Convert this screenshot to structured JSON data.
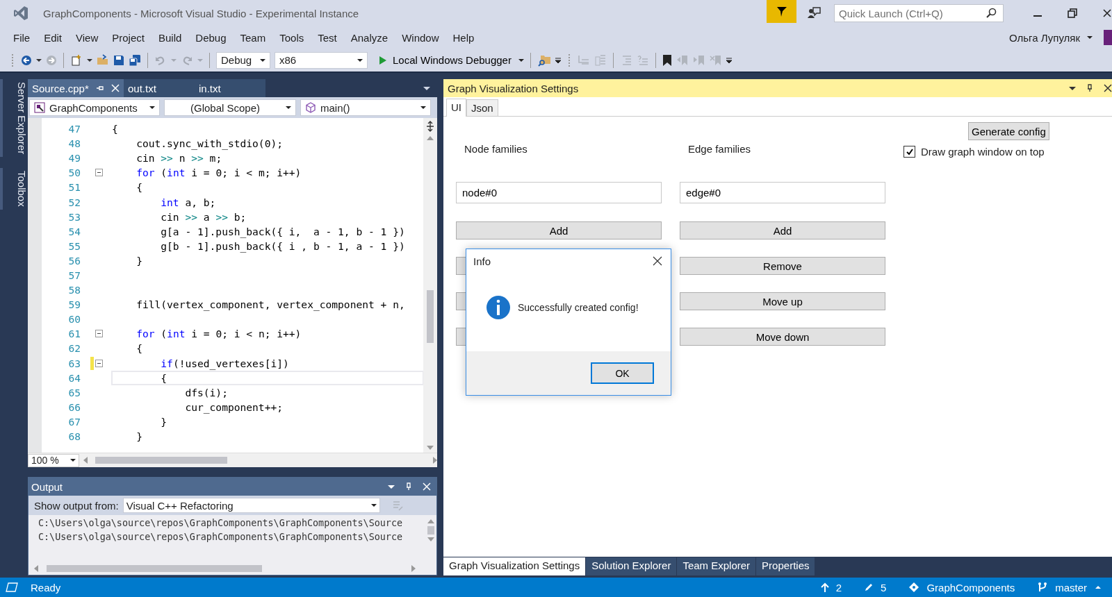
{
  "window": {
    "title": "GraphComponents - Microsoft Visual Studio  - Experimental Instance",
    "quick_launch": {
      "placeholder": "Quick Launch (Ctrl+Q)"
    },
    "user": "Ольга Лупуляк"
  },
  "menu": [
    "File",
    "Edit",
    "View",
    "Project",
    "Build",
    "Debug",
    "Team",
    "Tools",
    "Test",
    "Analyze",
    "Window",
    "Help"
  ],
  "toolbar": {
    "configuration": "Debug",
    "platform": "x86",
    "debugger": "Local Windows Debugger"
  },
  "side_tabs": [
    "Server Explorer",
    "Toolbox"
  ],
  "editor": {
    "tabs": [
      {
        "label": "Source.cpp*",
        "selected": true
      },
      {
        "label": "out.txt",
        "selected": false
      },
      {
        "label": "in.txt",
        "selected": false
      }
    ],
    "nav": [
      "GraphComponents",
      "(Global Scope)",
      "main()"
    ],
    "lines": [
      {
        "number": "47",
        "fold": false,
        "changed": false,
        "current": false,
        "tokens": [
          {
            "text": "{",
            "kind": "plain"
          }
        ]
      },
      {
        "number": "48",
        "fold": false,
        "changed": false,
        "current": false,
        "tokens": [
          {
            "text": "    cout.sync_with_stdio(0);",
            "kind": "plain"
          }
        ]
      },
      {
        "number": "49",
        "fold": false,
        "changed": false,
        "current": false,
        "tokens": [
          {
            "text": "    cin ",
            "kind": "plain"
          },
          {
            "text": ">>",
            "kind": "operator"
          },
          {
            "text": " n ",
            "kind": "plain"
          },
          {
            "text": ">>",
            "kind": "operator"
          },
          {
            "text": " m;",
            "kind": "plain"
          }
        ]
      },
      {
        "number": "50",
        "fold": true,
        "changed": false,
        "current": false,
        "tokens": [
          {
            "text": "    for",
            "kind": "keyword"
          },
          {
            "text": " (",
            "kind": "plain"
          },
          {
            "text": "int",
            "kind": "keyword"
          },
          {
            "text": " i = 0; i < m; i++)",
            "kind": "plain"
          }
        ]
      },
      {
        "number": "51",
        "fold": false,
        "changed": false,
        "current": false,
        "tokens": [
          {
            "text": "    {",
            "kind": "plain"
          }
        ]
      },
      {
        "number": "52",
        "fold": false,
        "changed": false,
        "current": false,
        "tokens": [
          {
            "text": "        int",
            "kind": "keyword"
          },
          {
            "text": " a, b;",
            "kind": "plain"
          }
        ]
      },
      {
        "number": "53",
        "fold": false,
        "changed": false,
        "current": false,
        "tokens": [
          {
            "text": "        cin ",
            "kind": "plain"
          },
          {
            "text": ">>",
            "kind": "operator"
          },
          {
            "text": " a ",
            "kind": "plain"
          },
          {
            "text": ">>",
            "kind": "operator"
          },
          {
            "text": " b;",
            "kind": "plain"
          }
        ]
      },
      {
        "number": "54",
        "fold": false,
        "changed": false,
        "current": false,
        "tokens": [
          {
            "text": "        g[a - 1].push_back({ i,  a - 1, b - 1 })",
            "kind": "plain"
          }
        ]
      },
      {
        "number": "55",
        "fold": false,
        "changed": false,
        "current": false,
        "tokens": [
          {
            "text": "        g[b - 1].push_back({ i , b - 1, a - 1 })",
            "kind": "plain"
          }
        ]
      },
      {
        "number": "56",
        "fold": false,
        "changed": false,
        "current": false,
        "tokens": [
          {
            "text": "    }",
            "kind": "plain"
          }
        ]
      },
      {
        "number": "57",
        "fold": false,
        "changed": false,
        "current": false
      },
      {
        "number": "58",
        "fold": false,
        "changed": false,
        "current": false
      },
      {
        "number": "59",
        "fold": false,
        "changed": false,
        "current": false,
        "tokens": [
          {
            "text": "    fill(vertex_component, vertex_component + n,",
            "kind": "plain"
          }
        ]
      },
      {
        "number": "60",
        "fold": false,
        "changed": false,
        "current": false
      },
      {
        "number": "61",
        "fold": true,
        "changed": false,
        "current": false,
        "tokens": [
          {
            "text": "    for",
            "kind": "keyword"
          },
          {
            "text": " (",
            "kind": "plain"
          },
          {
            "text": "int",
            "kind": "keyword"
          },
          {
            "text": " i = 0; i < n; i++)",
            "kind": "plain"
          }
        ]
      },
      {
        "number": "62",
        "fold": false,
        "changed": false,
        "current": false,
        "tokens": [
          {
            "text": "    {",
            "kind": "plain"
          }
        ]
      },
      {
        "number": "63",
        "fold": true,
        "changed": true,
        "current": false,
        "tokens": [
          {
            "text": "        if",
            "kind": "keyword"
          },
          {
            "text": "(!used_vertexes[i])",
            "kind": "plain"
          }
        ]
      },
      {
        "number": "64",
        "fold": false,
        "changed": false,
        "current": true,
        "tokens": [
          {
            "text": "        {",
            "kind": "plain"
          }
        ]
      },
      {
        "number": "65",
        "fold": false,
        "changed": false,
        "current": false,
        "tokens": [
          {
            "text": "            dfs(i);",
            "kind": "plain"
          }
        ]
      },
      {
        "number": "66",
        "fold": false,
        "changed": false,
        "current": false,
        "tokens": [
          {
            "text": "            cur_component++;",
            "kind": "plain"
          }
        ]
      },
      {
        "number": "67",
        "fold": false,
        "changed": false,
        "current": false,
        "tokens": [
          {
            "text": "        }",
            "kind": "plain"
          }
        ]
      },
      {
        "number": "68",
        "fold": false,
        "changed": false,
        "current": false,
        "tokens": [
          {
            "text": "    }",
            "kind": "plain"
          }
        ]
      }
    ],
    "zoom": "100 %"
  },
  "output": {
    "title": "Output",
    "source_label": "Show output from:",
    "source": "Visual C++ Refactoring",
    "lines": [
      "C:\\Users\\olga\\source\\repos\\GraphComponents\\GraphComponents\\Source",
      "C:\\Users\\olga\\source\\repos\\GraphComponents\\GraphComponents\\Source"
    ]
  },
  "settings": {
    "title": "Graph Visualization Settings",
    "tabs": [
      {
        "label": "UI",
        "selected": true
      },
      {
        "label": "Json",
        "selected": false
      }
    ],
    "node_families": {
      "label": "Node families",
      "value": "node#0",
      "buttons": [
        "Add"
      ]
    },
    "edge_families": {
      "label": "Edge families",
      "value": "edge#0",
      "buttons": [
        "Add",
        "Remove",
        "Move up",
        "Move down"
      ]
    },
    "generate_button": "Generate config",
    "draw_on_top": {
      "label": "Draw graph window on top",
      "checked": true
    },
    "bottom_tabs": [
      {
        "label": "Graph Visualization Settings",
        "selected": true
      },
      {
        "label": "Solution Explorer",
        "selected": false
      },
      {
        "label": "Team Explorer",
        "selected": false
      },
      {
        "label": "Properties",
        "selected": false
      }
    ]
  },
  "dialog": {
    "title": "Info",
    "message": "Successfully created config!",
    "button": "OK"
  },
  "status_bar": {
    "text": "Ready",
    "pushes": "2",
    "changes": "5",
    "repository": "GraphComponents",
    "branch": "master"
  }
}
